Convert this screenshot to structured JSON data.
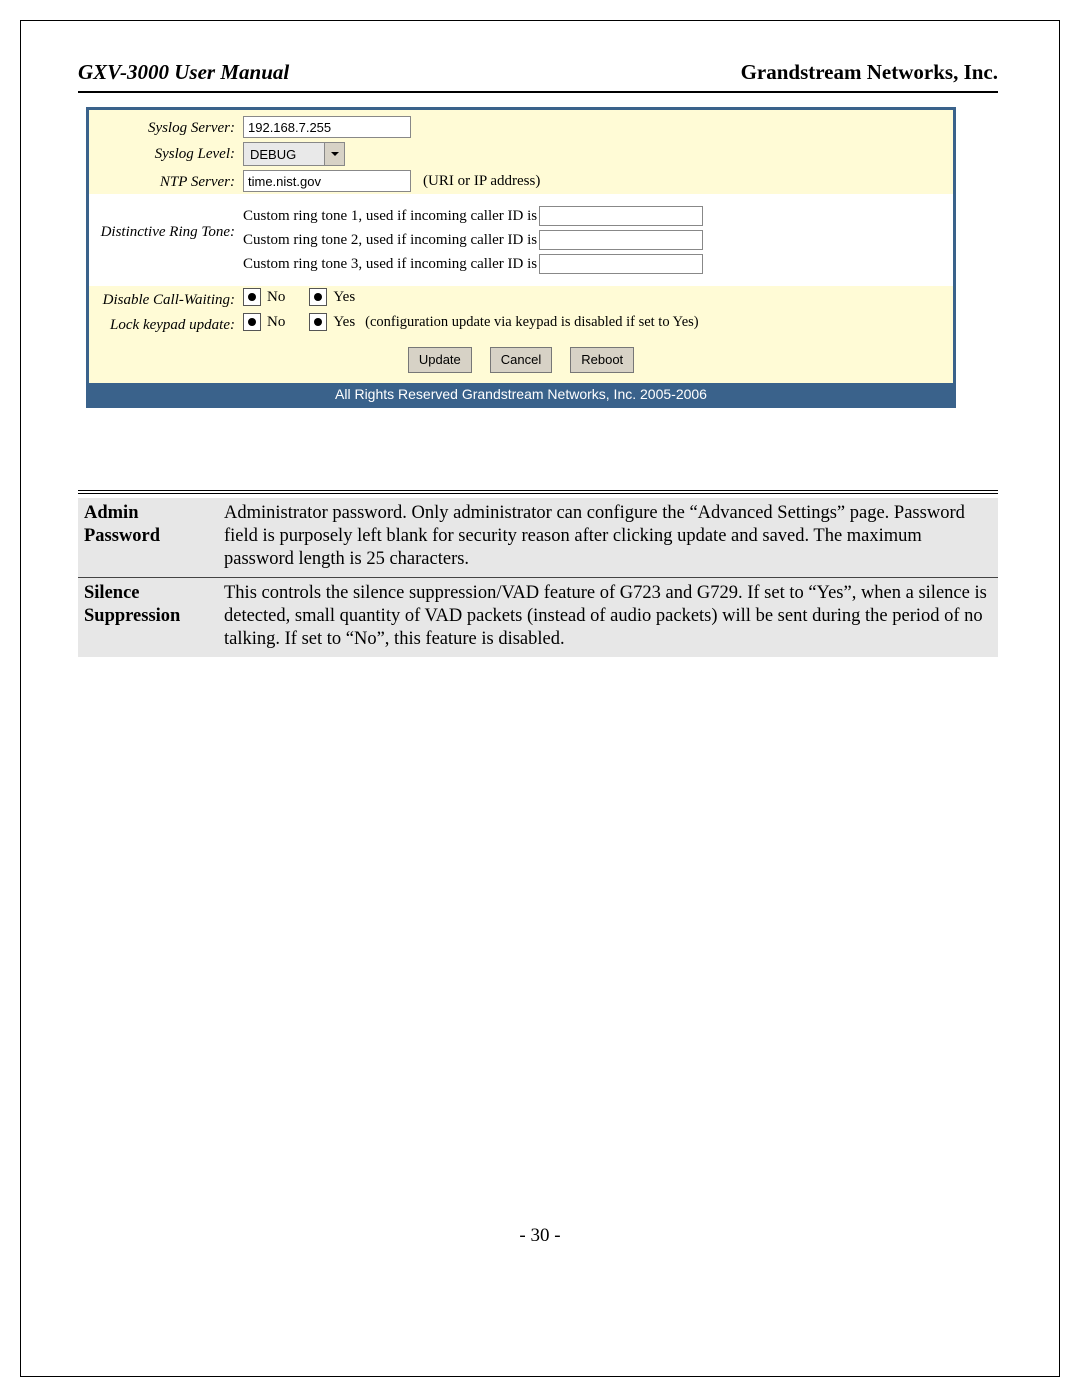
{
  "header": {
    "left": "GXV-3000 User Manual",
    "right": "Grandstream Networks, Inc."
  },
  "form": {
    "syslog_server_label": "Syslog Server:",
    "syslog_server_value": "192.168.7.255",
    "syslog_level_label": "Syslog Level:",
    "syslog_level_value": "DEBUG",
    "ntp_server_label": "NTP Server:",
    "ntp_server_value": "time.nist.gov",
    "ntp_hint": "(URI or IP address)",
    "ring_label": "Distinctive Ring Tone:",
    "ring1": "Custom ring tone 1, used if incoming caller ID is",
    "ring2": "Custom ring tone 2, used if incoming caller ID is",
    "ring3": "Custom ring tone 3, used if incoming caller ID is",
    "dcw_label": "Disable Call-Waiting:",
    "lku_label": "Lock keypad update:",
    "opt_no": "No",
    "opt_yes": "Yes",
    "lku_note": "(configuration update via keypad is disabled if set to Yes)",
    "btn_update": "Update",
    "btn_cancel": "Cancel",
    "btn_reboot": "Reboot",
    "footer": "All Rights Reserved Grandstream Networks, Inc. 2005-2006"
  },
  "desc": {
    "row1_label": "Admin Password",
    "row1_text": "Administrator password. Only administrator can configure the “Advanced Settings” page. Password field is purposely left blank for security reason after clicking update and saved. The maximum password length is 25 characters.",
    "row2_label": "Silence Suppression",
    "row2_text": "This controls the silence suppression/VAD feature of G723 and G729. If set to “Yes”, when a silence is detected, small quantity of VAD packets (instead of audio packets) will be sent during the period of no talking.  If set to “No”, this feature is disabled."
  },
  "page_number": "- 30 -"
}
